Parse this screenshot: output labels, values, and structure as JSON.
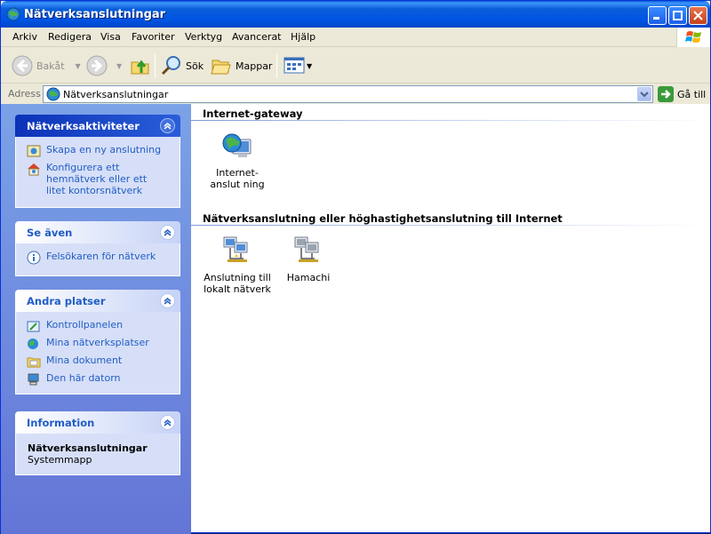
{
  "window": {
    "title": "Nätverksanslutningar"
  },
  "menu": [
    "Arkiv",
    "Redigera",
    "Visa",
    "Favoriter",
    "Verktyg",
    "Avancerat",
    "Hjälp"
  ],
  "toolbar": {
    "back": "Bakåt",
    "search": "Sök",
    "folders": "Mappar"
  },
  "address": {
    "label": "Adress",
    "value": "Nätverksanslutningar",
    "go": "Gå till"
  },
  "panels": {
    "tasks": {
      "title": "Nätverksaktiviteter",
      "links": [
        "Skapa en ny anslutning",
        "Konfigurera ett hemnätverk eller ett litet kontorsnätverk"
      ]
    },
    "see_also": {
      "title": "Se även",
      "links": [
        "Felsökaren för nätverk"
      ]
    },
    "other_places": {
      "title": "Andra platser",
      "links": [
        "Kontrollpanelen",
        "Mina nätverksplatser",
        "Mina dokument",
        "Den här datorn"
      ]
    },
    "info": {
      "title": "Information",
      "name": "Nätverksanslutningar",
      "type": "Systemmapp"
    }
  },
  "groups": {
    "gateway": {
      "title": "Internet-gateway",
      "items": [
        "Internet-anslut ning"
      ]
    },
    "lan": {
      "title": "Nätverksanslutning eller höghastighetsanslutning till Internet",
      "items": [
        "Anslutning till lokalt nätverk",
        "Hamachi"
      ]
    }
  },
  "icons": {
    "app": "network-connections-icon",
    "back": "back-arrow-icon",
    "forward": "forward-arrow-icon",
    "up": "folder-up-icon",
    "search": "search-icon",
    "folders": "folders-icon",
    "views": "views-icon",
    "go": "go-arrow-icon"
  },
  "colors": {
    "titlebar": "#0054e3",
    "leftpane": "#7ba2e7",
    "link": "#215dc6"
  }
}
